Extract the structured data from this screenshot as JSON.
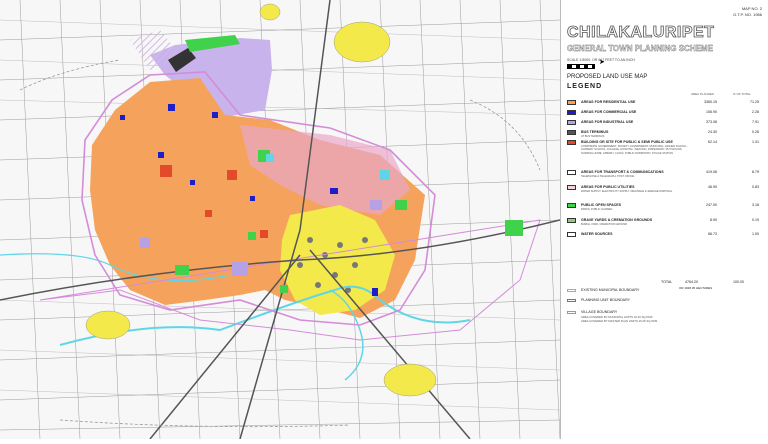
{
  "title": "CHILAKALURIPET",
  "subtitle": "GENERAL TOWN PLANNING SCHEME",
  "map_no": [
    "MAP NO. 2",
    "G.T.P. NO. 1986"
  ],
  "scale_text": "SCALE 1:8000, OR 667 FEET TO AN INCH",
  "map_type": "PROPOSED LAND USE MAP",
  "legend_heading": "LEGEND",
  "col_area": "AREA IN ACRES",
  "col_percent": "% OF TOTAL",
  "legend": [
    {
      "name": "AREAS FOR RESIDENTIAL USE",
      "desc": "",
      "area": "3360.15",
      "pct": "71.25",
      "color": "#f5a35c",
      "icon": "residential-swatch"
    },
    {
      "name": "AREAS FOR COMMERCIAL USE",
      "desc": "",
      "area": "106.90",
      "pct": "2.26",
      "color": "#1e1ec8",
      "icon": "commercial-swatch"
    },
    {
      "name": "AREAS FOR INDUSTRIAL USE",
      "desc": "",
      "area": "373.08",
      "pct": "7.91",
      "color": "#b6a0e6",
      "icon": "industrial-swatch"
    },
    {
      "name": "BUS TERMINUS",
      "desc": "AT BUS TERMINUS",
      "area": "24.30",
      "pct": "0.26",
      "color": "#555555",
      "icon": "bus-terminus-swatch"
    },
    {
      "name": "BUILDING OR SITE FOR PUBLIC & SEMI PUBLIC USE",
      "desc": "CORPORATE GOVERNMENT, SOCIETY GOVERNMENT, MUNICIPAL, HIGHER SCHOOL, NURSERY SCHOOL, COLLEGE, HOSPITAL, WEAVING, DISPENSARY, PHYSICIANS, NURSING HOME, LIBRARY, CLINIC, PUBLIC DORMITORY, POLICE STATION",
      "area": "62.14",
      "pct": "1.31",
      "color": "#e24a2a",
      "icon": "public-use-swatch"
    },
    {
      "name": "AREAS FOR TRANSPORT & COMMUNICATIONS",
      "desc": "TELEPHONE & TELEGRAPH, POST OFFICE",
      "area": "419.06",
      "pct": "8.79",
      "color": "#ffffff",
      "icon": "transport-swatch"
    },
    {
      "name": "AREAS FOR PUBLIC UTILITIES",
      "desc": "WATER SUPPLY, ELECTRICITY SUPPLY, DRAINAGE & SEWAGE DISPOSAL",
      "area": "46.90",
      "pct": "0.83",
      "color": "#f7d4d8",
      "icon": "utilities-swatch"
    },
    {
      "name": "PUBLIC OPEN SPACES",
      "desc": "PARKS, PUBLIC GARDEN",
      "area": "247.00",
      "pct": "3.18",
      "color": "#3fd24a",
      "icon": "open-space-swatch"
    },
    {
      "name": "GRAVE YARDS & CREMATION GROUNDS",
      "desc": "BURIAL YARD, CREMATION GROUND",
      "area": "8.90",
      "pct": "0.19",
      "color": "#8fcf7c",
      "icon": "graveyard-swatch"
    },
    {
      "name": "WATER SOURCES",
      "desc": "",
      "area": "66.73",
      "pct": "1.00",
      "color": "#ffffff",
      "icon": "water-swatch"
    }
  ],
  "total_label": "TOTAL",
  "total_area": "4764.20",
  "total_pct": "100.00",
  "total_note": "OR 1928.05 HECTARES",
  "boundaries": [
    {
      "name": "EXISTING MUNICIPAL BOUNDARY",
      "desc": "",
      "color": "#d48cd8"
    },
    {
      "name": "PLANNING UNIT BOUNDARY",
      "desc": "",
      "color": "#777777"
    },
    {
      "name": "VILLAGE BOUNDARY",
      "desc": "AREA COVERED BY MUNICIPAL LIMITS   10.20 SQ.KMS\nAREA COVERED BY MASTER PLAN LIMITS   19.25 SQ.KMS",
      "color": "#999999"
    }
  ],
  "colors": {
    "residential": "#f5a35c",
    "commercial": "#1e1ec8",
    "industrial": "#b6a0e6",
    "open_space": "#3fd24a",
    "boundary": "#d48cd8",
    "water": "#5fd6e8",
    "town_core": "#f3e94a",
    "road": "#444444"
  }
}
